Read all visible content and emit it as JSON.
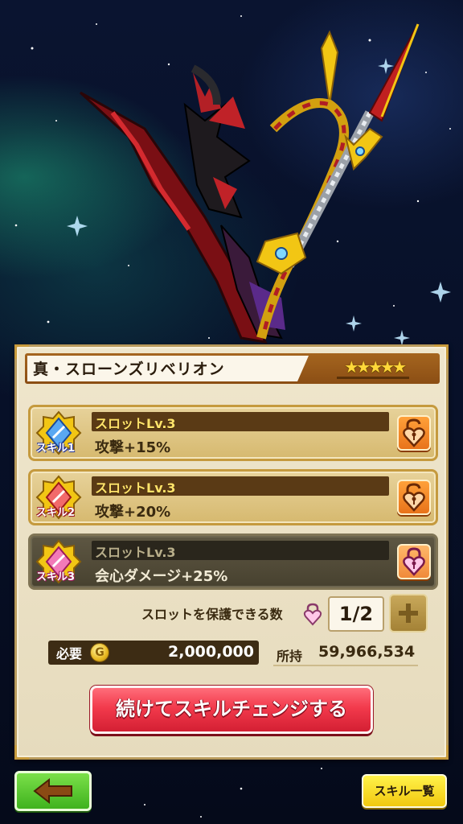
{
  "weapon": {
    "name": "真・スローンズリベリオン",
    "rarity_stars": 5,
    "rarity_text": "★★★★★"
  },
  "slots": [
    {
      "badge": "スキル1",
      "level": "スロットLv.3",
      "effect": "攻撃+15%",
      "lock_state": "unlocked",
      "badge_color": "#4a8ad8"
    },
    {
      "badge": "スキル2",
      "level": "スロットLv.3",
      "effect": "攻撃+20%",
      "lock_state": "unlocked",
      "badge_color": "#e84a5a"
    },
    {
      "badge": "スキル3",
      "level": "スロットLv.3",
      "effect": "会心ダメージ+25%",
      "lock_state": "locked",
      "badge_color": "#e84a9a"
    }
  ],
  "protect": {
    "label": "スロットを保護できる数",
    "count": "1/2",
    "plus_icon": "plus-icon"
  },
  "cost": {
    "label": "必要",
    "coin_symbol": "G",
    "value": "2,000,000"
  },
  "owned": {
    "label": "所持",
    "value": "59,966,534"
  },
  "main_button": "続けてスキルチェンジする",
  "nav": {
    "back_icon": "left-arrow-icon",
    "skill_list": "スキル一覧"
  },
  "colors": {
    "panel": "#efe6cc",
    "title_bar": "#8b4e14",
    "main_button": "#f23a4c",
    "back_button": "#3fb21e",
    "skill_list_button": "#f2c80f"
  }
}
